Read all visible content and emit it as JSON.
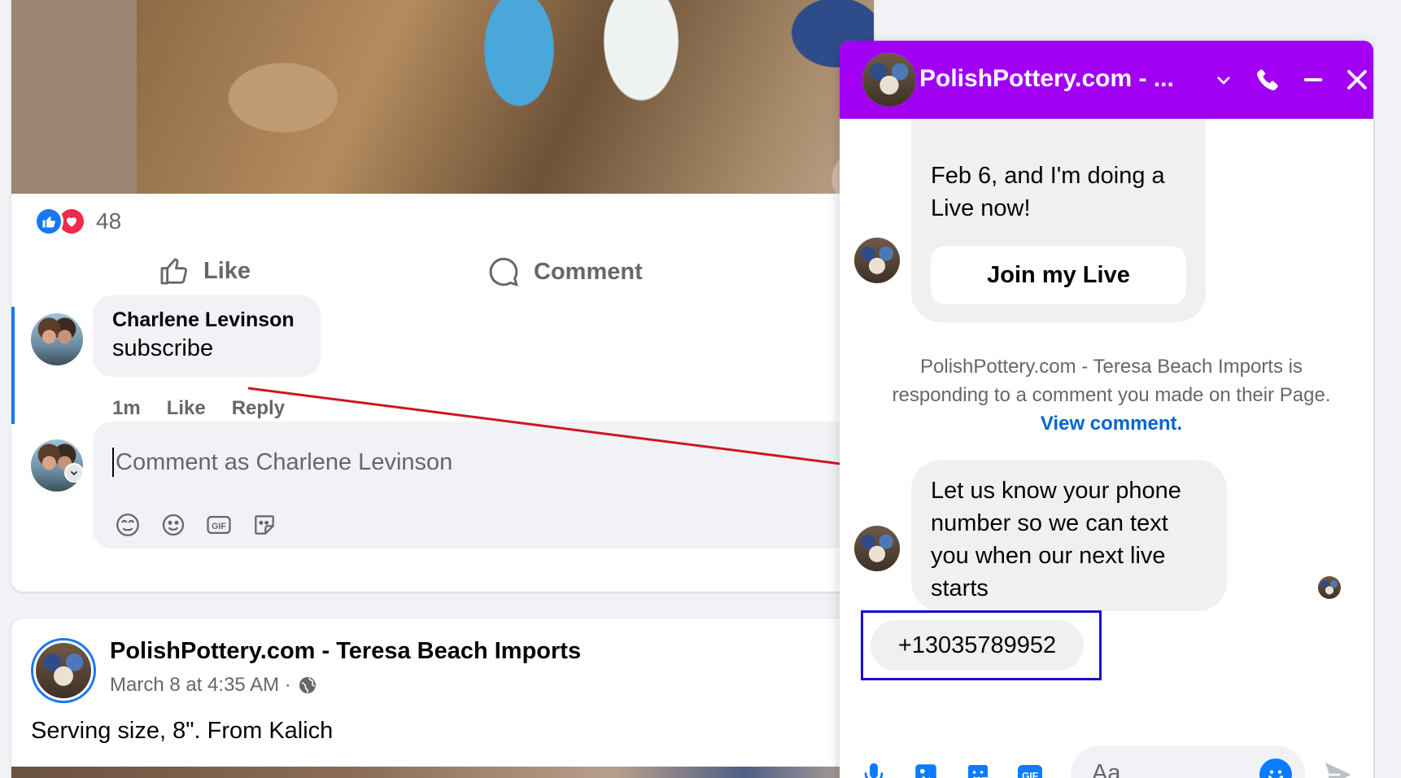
{
  "post1": {
    "reaction_count": "48",
    "like_label": "Like",
    "comment_label": "Comment",
    "comment": {
      "author": "Charlene Levinson",
      "text": "subscribe",
      "time": "1m",
      "like_label": "Like",
      "reply_label": "Reply"
    },
    "compose_placeholder": "Comment as Charlene Levinson",
    "compose_icons": [
      "avatar-sticker-icon",
      "emoji-icon",
      "gif-icon",
      "sticker-icon"
    ]
  },
  "post2": {
    "page_name": "PolishPottery.com - Teresa Beach Imports",
    "timestamp": "March 8 at 4:35 AM · ",
    "text": "Serving size, 8\". From Kalich"
  },
  "chat": {
    "title": "PolishPottery.com - ...",
    "header_color": "#a100f2",
    "message1_text": "Feb 6, and I'm doing a Live now!",
    "join_button": "Join my Live",
    "system_note_text": "PolishPottery.com - Teresa Beach Imports is responding to a comment you made on their Page. ",
    "system_note_link": "View comment.",
    "message2_text": "Let us know your phone number so we can text you when our next live starts",
    "reply_text": "+13035789952",
    "input_placeholder": "Aa",
    "footer_icons": [
      "microphone-icon",
      "image-icon",
      "sticker-icon",
      "gif-icon"
    ]
  },
  "colors": {
    "facebook_blue": "#1877f2",
    "messenger_purple": "#a100f2",
    "annotation_red": "#d0161d",
    "annotation_blue": "#1a10c8"
  }
}
